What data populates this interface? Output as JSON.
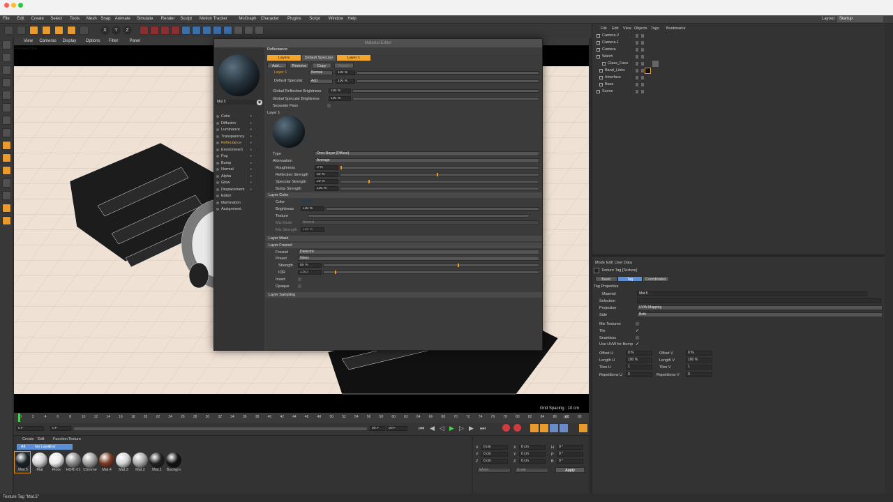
{
  "app": {
    "menu": [
      "File",
      "Edit",
      "Create",
      "Select",
      "Tools",
      "Mesh",
      "Snap",
      "Animate",
      "Simulate",
      "Render",
      "Sculpt",
      "Motion Tracker",
      "MoGraph",
      "Character",
      "Plugins",
      "Script",
      "Window",
      "Help"
    ],
    "layout_label": "Layout:",
    "layout_value": "Startup",
    "toolbar_axes": [
      "X",
      "Y",
      "Z"
    ]
  },
  "viewport": {
    "menu": [
      "View",
      "Cameras",
      "Display",
      "Options",
      "Filter",
      "Panel"
    ],
    "label": "Perspective",
    "grid_spacing": "Grid Spacing : 10 cm"
  },
  "timeline": {
    "ticks": [
      "0",
      "2",
      "4",
      "6",
      "8",
      "10",
      "12",
      "14",
      "16",
      "18",
      "20",
      "22",
      "24",
      "26",
      "28",
      "30",
      "32",
      "34",
      "36",
      "38",
      "40",
      "42",
      "44",
      "46",
      "48",
      "50",
      "52",
      "54",
      "56",
      "58",
      "60",
      "62",
      "64",
      "66",
      "68",
      "70",
      "72",
      "74",
      "76",
      "78",
      "80",
      "82",
      "84",
      "86",
      "88",
      "90"
    ],
    "current_frame": "0 F",
    "start": "0 F",
    "end": "90 F",
    "end2": "90 F",
    "frame_readout": "0 F"
  },
  "material_manager": {
    "menu": [
      "Create",
      "Edit",
      "Function",
      "Texture"
    ],
    "filters": [
      "All",
      "No Layer",
      "Env"
    ],
    "materials": [
      {
        "name": "Mat.5",
        "color": "#1a2228"
      },
      {
        "name": "Mat",
        "color": "#cfcfcf"
      },
      {
        "name": "Floor",
        "color": "#e8e8e8"
      },
      {
        "name": "HDRI 01",
        "color": "#8a8a8a"
      },
      {
        "name": "Chrome",
        "color": "#9c9c9c"
      },
      {
        "name": "Mat.4",
        "color": "#7a3a22"
      },
      {
        "name": "Mat.3",
        "color": "#d4d4d4"
      },
      {
        "name": "Mat.2",
        "color": "#a8a8a8"
      },
      {
        "name": "Mat.1",
        "color": "#202020"
      },
      {
        "name": "Backgro",
        "color": "#111111"
      }
    ]
  },
  "coordinates": {
    "rows": [
      {
        "a": "X",
        "av": "0 cm",
        "b": "X",
        "bv": "0 cm",
        "c": "H",
        "cv": "0 °"
      },
      {
        "a": "Y",
        "av": "0 cm",
        "b": "Y",
        "bv": "0 cm",
        "c": "P",
        "cv": "0 °"
      },
      {
        "a": "Z",
        "av": "0 cm",
        "b": "Z",
        "bv": "0 cm",
        "c": "B",
        "cv": "0 °"
      }
    ],
    "world": "World",
    "scale": "Scale",
    "apply": "Apply"
  },
  "object_manager": {
    "menu": [
      "File",
      "Edit",
      "View",
      "Objects",
      "Tags",
      "Bookmarks"
    ],
    "objects": [
      "Camera.2",
      "Camera.1",
      "Camera",
      "Watch",
      "Glass_Face",
      "Band_Links",
      "Innerface",
      "Base",
      "Scene"
    ]
  },
  "attribute_manager": {
    "menu": [
      "Mode",
      "Edit",
      "User Data"
    ],
    "title": "Texture Tag [Texture]",
    "tabs": [
      "Basic",
      "Tag",
      "Coordinates"
    ],
    "section": "Tag Properties",
    "material_label": "Material",
    "material_value": "Mat.5",
    "selection_label": "Selection",
    "projection_label": "Projection",
    "projection_value": "UVW Mapping",
    "side_label": "Side",
    "side_value": "Both",
    "mix_textures": "Mix Textures",
    "tile": "Tile",
    "seamless": "Seamless",
    "use_uvw": "Use UVW for Bump",
    "offset_u": "Offset U",
    "offset_u_val": "0 %",
    "offset_v": "Offset V",
    "offset_v_val": "0 %",
    "length_u": "Length U",
    "length_u_val": "100 %",
    "length_v": "Length V",
    "length_v_val": "100 %",
    "tiles_u": "Tiles U",
    "tiles_u_val": "1",
    "tiles_v": "Tiles V",
    "tiles_v_val": "1",
    "rep_u": "Repetitions U",
    "rep_u_val": "0",
    "rep_v": "Repetitions V",
    "rep_v_val": "0"
  },
  "material_editor": {
    "title": "Material Editor",
    "material_name": "Mat.5",
    "channels": [
      "Color",
      "Diffusion",
      "Luminance",
      "Transparency",
      "Reflectance",
      "Environment",
      "Fog",
      "Bump",
      "Normal",
      "Alpha",
      "Glow",
      "Displacement",
      "Editor",
      "Illumination",
      "Assignment"
    ],
    "active_channel": "Reflectance",
    "heading": "Reflectance",
    "layer_tabs": [
      "Layers",
      "Default Specular",
      "Layer 1"
    ],
    "layer_buttons": [
      "Add...",
      "Remove",
      "Copy",
      "Paste"
    ],
    "layers": [
      {
        "name": "Layer 1",
        "mode": "Normal",
        "value": "100 %"
      },
      {
        "name": "Default Specular",
        "mode": "Add",
        "value": "100 %"
      }
    ],
    "global_reflection": "Global Reflection Brightness",
    "global_reflection_val": "100 %",
    "global_specular": "Global Specular Brightness",
    "global_specular_val": "100 %",
    "separate_pass": "Separate Pass",
    "layer_heading": "Layer 1",
    "type_label": "Type",
    "type_value": "Oren-Nayar (Diffuse)",
    "attenuation_label": "Attenuation",
    "attenuation_value": "Average",
    "roughness_label": "Roughness",
    "roughness_val": "0 %",
    "roughness_frac": 0.0,
    "refl_strength_label": "Reflection Strength",
    "refl_strength_val": "69 %",
    "refl_strength_frac": 0.69,
    "spec_strength_label": "Specular Strength",
    "spec_strength_val": "20 %",
    "spec_strength_frac": 0.2,
    "bump_strength_label": "Bump Strength",
    "bump_strength_val": "100 %",
    "layer_color": "Layer Color",
    "color_label": "Color",
    "brightness_label": "Brightness",
    "brightness_val": "100 %",
    "texture_label": "Texture",
    "mix_mode_label": "Mix Mode",
    "mix_mode_val": "Normal",
    "mix_strength_label": "Mix Strength",
    "mix_strength_val": "100 %",
    "layer_mask": "Layer Mask",
    "layer_fresnel": "Layer Fresnel",
    "fresnel_label": "Fresnel",
    "fresnel_val": "Dielectric",
    "preset_label": "Preset",
    "preset_val": "Glass",
    "strength_label": "Strength",
    "strength_val": "80 %",
    "strength_frac": 0.8,
    "ior_label": "IOR",
    "ior_val": "1.517",
    "invert_label": "Invert",
    "opaque_label": "Opaque",
    "layer_sampling": "Layer Sampling"
  },
  "status": "Texture Tag \"Mat.5\"",
  "colors": {
    "accent": "#f3a52b",
    "selected_blue": "#5b8fd6"
  }
}
